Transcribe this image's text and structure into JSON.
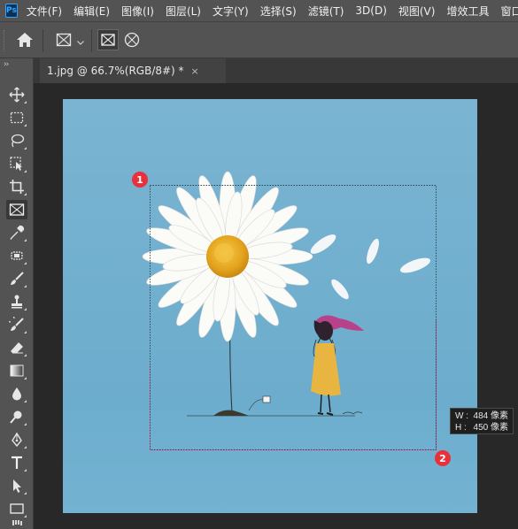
{
  "app": {
    "logo_text": "Ps"
  },
  "menu": [
    "文件(F)",
    "编辑(E)",
    "图像(I)",
    "图层(L)",
    "文字(Y)",
    "选择(S)",
    "滤镜(T)",
    "3D(D)",
    "视图(V)",
    "增效工具",
    "窗口(W)"
  ],
  "toolbar_collapse": "››",
  "document": {
    "tab_title": "1.jpg @ 66.7%(RGB/8#) *",
    "close_glyph": "×"
  },
  "markers": [
    "1",
    "2"
  ],
  "tooltip": {
    "w_label": "W :",
    "w_value": "484 像素",
    "h_label": "H :",
    "h_value": "450 像素"
  },
  "colors": {
    "accent": "#31a8ff",
    "marker": "#e8313b",
    "sky": "#76b3d1",
    "dress": "#e8b640",
    "hair": "#b8428a"
  }
}
